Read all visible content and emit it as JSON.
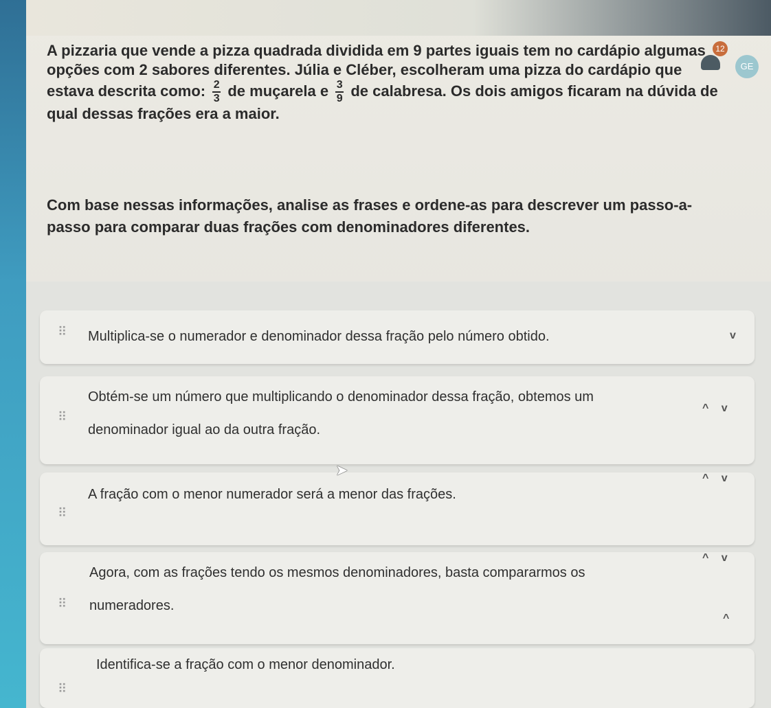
{
  "question": {
    "line1": "A pizzaria que vende a pizza quadrada dividida em 9 partes iguais tem no cardápio algumas",
    "line2": "opções com 2 sabores diferentes. Júlia e Cléber, escolheram uma pizza do cardápio que",
    "line3_pre": "estava descrita como:",
    "frac1_num": "2",
    "frac1_den": "3",
    "line3_mid": "de muçarela e",
    "frac2_num": "3",
    "frac2_den": "9",
    "line3_post": "de calabresa. Os dois amigos ficaram na dúvida de",
    "line4": "qual dessas frações era a maior."
  },
  "instruction": {
    "line1": "Com base nessas informações, analise as frases e ordene-as para descrever um passo-a-",
    "line2": "passo para comparar duas frações com denominadores diferentes."
  },
  "header": {
    "notification_count": "12",
    "avatar_initials": "GE"
  },
  "items": [
    {
      "line1": "Multiplica-se o numerador e denominador dessa fração pelo número obtido.",
      "line2": ""
    },
    {
      "line1": "Obtém-se um número que multiplicando o denominador dessa fração, obtemos um",
      "line2": "denominador igual ao da outra fração."
    },
    {
      "line1": "A fração com o menor numerador será a menor das frações.",
      "line2": ""
    },
    {
      "line1": "Agora, com as frações tendo os mesmos denominadores, basta compararmos os",
      "line2": "numeradores."
    },
    {
      "line1": "Identifica-se a fração com o menor denominador.",
      "line2": ""
    }
  ],
  "icons": {
    "drag": "⠿",
    "up": "^",
    "down": "v"
  }
}
